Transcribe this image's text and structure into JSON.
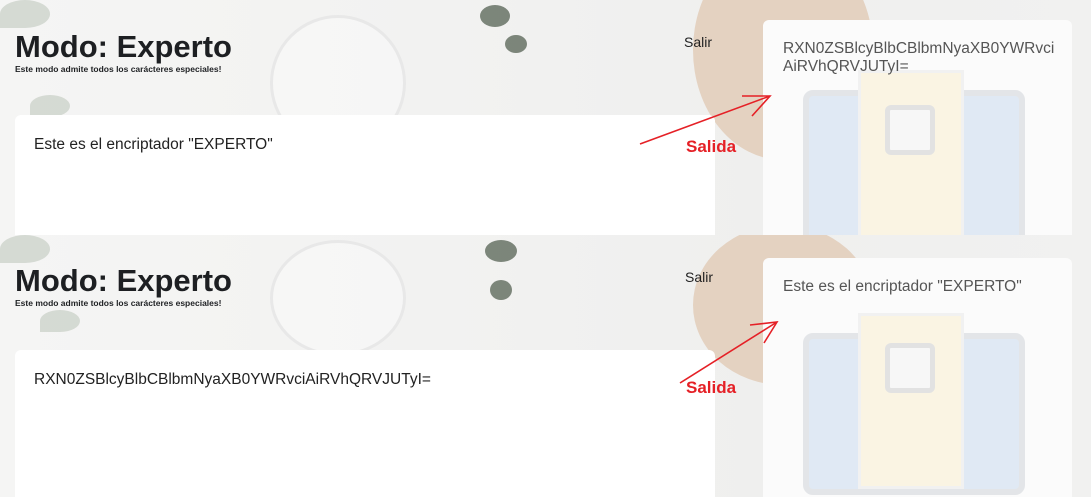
{
  "top": {
    "title": "Modo: Experto",
    "subtitle": "Este modo admite todos los carácteres especiales!",
    "exit_label": "Salir",
    "input_text": "Este es el encriptador \"EXPERTO\"",
    "output_text": "RXN0ZSBlcyBlbCBlbmNyaXB0YWRvciAiRVhQRVJUTyI=",
    "annotation": "Salida"
  },
  "bottom": {
    "title": "Modo: Experto",
    "subtitle": "Este modo admite todos los carácteres especiales!",
    "exit_label": "Salir",
    "input_text": "RXN0ZSBlcyBlbCBlbmNyaXB0YWRvciAiRVhQRVJUTyI=",
    "output_text": "Este es el encriptador \"EXPERTO\"",
    "annotation": "Salida"
  },
  "colors": {
    "annotation": "#e52026",
    "title": "#1d1f22",
    "card": "#ffffff"
  }
}
